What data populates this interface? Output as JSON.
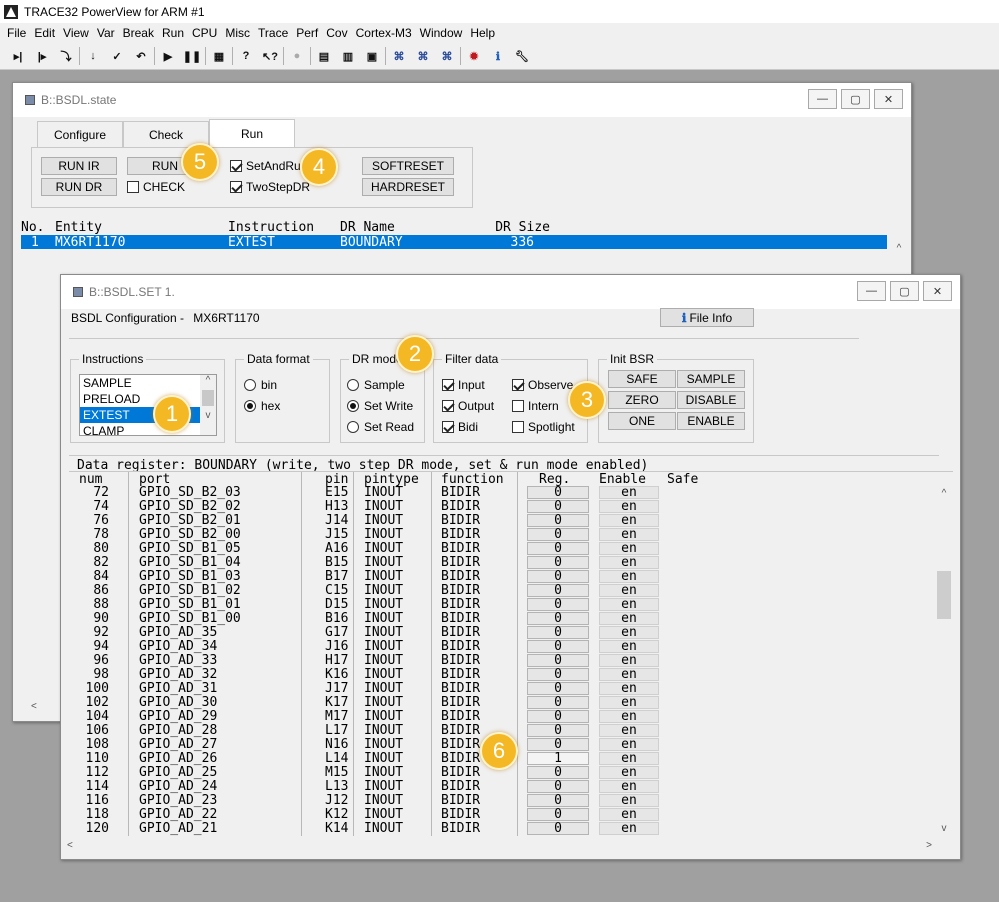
{
  "app": {
    "title": "TRACE32 PowerView for ARM #1",
    "menu": [
      "File",
      "Edit",
      "View",
      "Var",
      "Break",
      "Run",
      "CPU",
      "Misc",
      "Trace",
      "Perf",
      "Cov",
      "Cortex-M3",
      "Window",
      "Help"
    ]
  },
  "toolbar_icons": [
    "step-into-icon",
    "step-over-icon",
    "step-asm-icon",
    "down-icon",
    "check-icon",
    "return-icon",
    "go-icon",
    "break-icon",
    "list-icon",
    "help-icon",
    "context-help-icon",
    "stop-icon",
    "grid-icon",
    "cpu-icon",
    "chip-icon",
    "analyzer-icon",
    "trace-icon",
    "perf-icon",
    "bug-icon",
    "info-icon",
    "wrench-icon"
  ],
  "state_window": {
    "title": "B::BSDL.state",
    "tabs": [
      "Configure",
      "Check",
      "Run"
    ],
    "active_tab": "Run",
    "buttons": {
      "run_ir": "RUN IR",
      "run": "RUN",
      "run_dr": "RUN DR",
      "softreset": "SOFTRESET",
      "hardreset": "HARDRESET"
    },
    "checks": {
      "check": "CHECK",
      "set_and_run": "SetAndRun",
      "two_step_dr": "TwoStepDR"
    },
    "columns": [
      "No.",
      "Entity",
      "Instruction",
      "DR Name",
      "DR Size"
    ],
    "row": {
      "no": "1",
      "entity": "MX6RT1170",
      "instruction": "EXTEST",
      "dr_name": "BOUNDARY",
      "dr_size": "336"
    }
  },
  "set_window": {
    "title": "B::BSDL.SET 1.",
    "config_label": "BSDL Configuration -",
    "config_device": "MX6RT1170",
    "file_info": "File Info",
    "instructions": {
      "label": "Instructions",
      "items": [
        "SAMPLE",
        "PRELOAD",
        "EXTEST",
        "CLAMP"
      ],
      "selected": "EXTEST"
    },
    "data_format": {
      "label": "Data format",
      "options": [
        "bin",
        "hex"
      ],
      "selected": "hex"
    },
    "dr_mode": {
      "label": "DR mode",
      "options": [
        "Sample",
        "Set Write",
        "Set Read"
      ],
      "selected": "Set Write"
    },
    "filter": {
      "label": "Filter data",
      "input": "Input",
      "observe": "Observe",
      "output": "Output",
      "intern": "Intern",
      "bidi": "Bidi",
      "spotlight": "Spotlight"
    },
    "init_bsr": {
      "label": "Init BSR",
      "buttons": [
        "SAFE",
        "SAMPLE",
        "ZERO",
        "DISABLE",
        "ONE",
        "ENABLE"
      ]
    },
    "dr_title": "Data register: BOUNDARY (write, two step DR mode, set & run mode enabled)",
    "columns": [
      "num",
      "port",
      "pin",
      "pintype",
      "function",
      "Reg.",
      "Enable",
      "Safe"
    ],
    "rows": [
      {
        "num": "72",
        "port": "GPIO_SD_B2_03",
        "pin": "E15",
        "pintype": "INOUT",
        "function": "BIDIR",
        "reg": "0",
        "enable": "en"
      },
      {
        "num": "74",
        "port": "GPIO_SD_B2_02",
        "pin": "H13",
        "pintype": "INOUT",
        "function": "BIDIR",
        "reg": "0",
        "enable": "en"
      },
      {
        "num": "76",
        "port": "GPIO_SD_B2_01",
        "pin": "J14",
        "pintype": "INOUT",
        "function": "BIDIR",
        "reg": "0",
        "enable": "en"
      },
      {
        "num": "78",
        "port": "GPIO_SD_B2_00",
        "pin": "J15",
        "pintype": "INOUT",
        "function": "BIDIR",
        "reg": "0",
        "enable": "en"
      },
      {
        "num": "80",
        "port": "GPIO_SD_B1_05",
        "pin": "A16",
        "pintype": "INOUT",
        "function": "BIDIR",
        "reg": "0",
        "enable": "en"
      },
      {
        "num": "82",
        "port": "GPIO_SD_B1_04",
        "pin": "B15",
        "pintype": "INOUT",
        "function": "BIDIR",
        "reg": "0",
        "enable": "en"
      },
      {
        "num": "84",
        "port": "GPIO_SD_B1_03",
        "pin": "B17",
        "pintype": "INOUT",
        "function": "BIDIR",
        "reg": "0",
        "enable": "en"
      },
      {
        "num": "86",
        "port": "GPIO_SD_B1_02",
        "pin": "C15",
        "pintype": "INOUT",
        "function": "BIDIR",
        "reg": "0",
        "enable": "en"
      },
      {
        "num": "88",
        "port": "GPIO_SD_B1_01",
        "pin": "D15",
        "pintype": "INOUT",
        "function": "BIDIR",
        "reg": "0",
        "enable": "en"
      },
      {
        "num": "90",
        "port": "GPIO_SD_B1_00",
        "pin": "B16",
        "pintype": "INOUT",
        "function": "BIDIR",
        "reg": "0",
        "enable": "en"
      },
      {
        "num": "92",
        "port": "GPIO_AD_35",
        "pin": "G17",
        "pintype": "INOUT",
        "function": "BIDIR",
        "reg": "0",
        "enable": "en"
      },
      {
        "num": "94",
        "port": "GPIO_AD_34",
        "pin": "J16",
        "pintype": "INOUT",
        "function": "BIDIR",
        "reg": "0",
        "enable": "en"
      },
      {
        "num": "96",
        "port": "GPIO_AD_33",
        "pin": "H17",
        "pintype": "INOUT",
        "function": "BIDIR",
        "reg": "0",
        "enable": "en"
      },
      {
        "num": "98",
        "port": "GPIO_AD_32",
        "pin": "K16",
        "pintype": "INOUT",
        "function": "BIDIR",
        "reg": "0",
        "enable": "en"
      },
      {
        "num": "100",
        "port": "GPIO_AD_31",
        "pin": "J17",
        "pintype": "INOUT",
        "function": "BIDIR",
        "reg": "0",
        "enable": "en"
      },
      {
        "num": "102",
        "port": "GPIO_AD_30",
        "pin": "K17",
        "pintype": "INOUT",
        "function": "BIDIR",
        "reg": "0",
        "enable": "en"
      },
      {
        "num": "104",
        "port": "GPIO_AD_29",
        "pin": "M17",
        "pintype": "INOUT",
        "function": "BIDIR",
        "reg": "0",
        "enable": "en"
      },
      {
        "num": "106",
        "port": "GPIO_AD_28",
        "pin": "L17",
        "pintype": "INOUT",
        "function": "BIDIR",
        "reg": "0",
        "enable": "en"
      },
      {
        "num": "108",
        "port": "GPIO_AD_27",
        "pin": "N16",
        "pintype": "INOUT",
        "function": "BIDIR",
        "reg": "0",
        "enable": "en"
      },
      {
        "num": "110",
        "port": "GPIO_AD_26",
        "pin": "L14",
        "pintype": "INOUT",
        "function": "BIDIR",
        "reg": "1",
        "enable": "en"
      },
      {
        "num": "112",
        "port": "GPIO_AD_25",
        "pin": "M15",
        "pintype": "INOUT",
        "function": "BIDIR",
        "reg": "0",
        "enable": "en"
      },
      {
        "num": "114",
        "port": "GPIO_AD_24",
        "pin": "L13",
        "pintype": "INOUT",
        "function": "BIDIR",
        "reg": "0",
        "enable": "en"
      },
      {
        "num": "116",
        "port": "GPIO_AD_23",
        "pin": "J12",
        "pintype": "INOUT",
        "function": "BIDIR",
        "reg": "0",
        "enable": "en"
      },
      {
        "num": "118",
        "port": "GPIO_AD_22",
        "pin": "K12",
        "pintype": "INOUT",
        "function": "BIDIR",
        "reg": "0",
        "enable": "en"
      },
      {
        "num": "120",
        "port": "GPIO_AD_21",
        "pin": "K14",
        "pintype": "INOUT",
        "function": "BIDIR",
        "reg": "0",
        "enable": "en"
      }
    ]
  },
  "badges": [
    "1",
    "2",
    "3",
    "4",
    "5",
    "6"
  ],
  "colors": {
    "selection": "#0078d7",
    "badge": "#f5b825",
    "background": "#a0a0a0"
  }
}
